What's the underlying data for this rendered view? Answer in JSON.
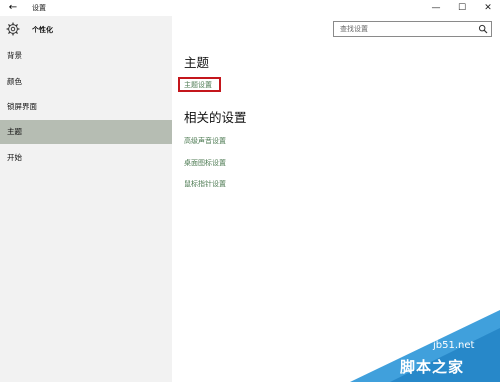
{
  "window": {
    "title": "设置",
    "controls": {
      "minimize": "—",
      "maximize": "☐",
      "close": "✕"
    }
  },
  "header": {
    "app_title": "个性化",
    "search": {
      "placeholder": "查找设置",
      "value": ""
    }
  },
  "sidebar": {
    "items": [
      {
        "label": "背景",
        "selected": false
      },
      {
        "label": "颜色",
        "selected": false
      },
      {
        "label": "锁屏界面",
        "selected": false
      },
      {
        "label": "主题",
        "selected": true
      },
      {
        "label": "开始",
        "selected": false
      }
    ]
  },
  "main": {
    "section_title": "主题",
    "theme_settings_link": "主题设置",
    "related_title": "相关的设置",
    "related_links": [
      "高级声音设置",
      "桌面图标设置",
      "鼠标指针设置"
    ]
  },
  "colors": {
    "sidebar_bg": "#f2f2f2",
    "selected_bg": "#b6bdb3",
    "link": "#4c7a52",
    "highlight": "#c4161c",
    "watermark": "#1f8fd6"
  },
  "watermark": {
    "site": "jb51.net",
    "brand": "脚本之家"
  }
}
